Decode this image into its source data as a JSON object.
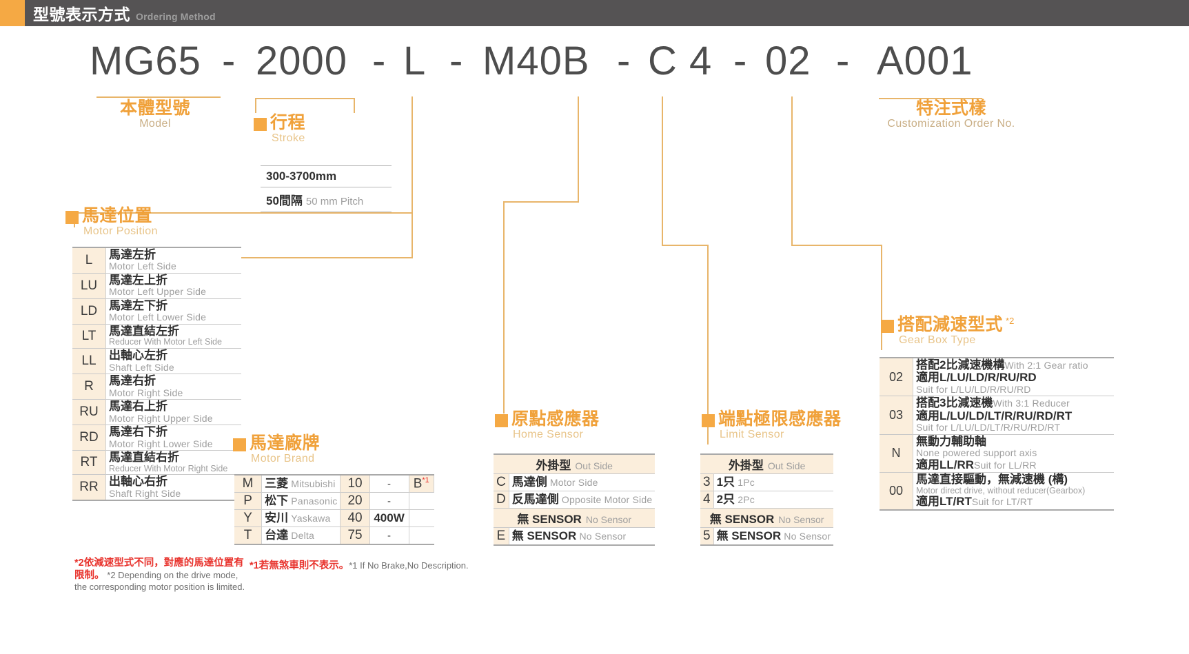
{
  "header": {
    "title_zh": "型號表示方式",
    "title_en": "Ordering Method"
  },
  "model_code": {
    "segments": [
      "MG65",
      "2000",
      "L",
      "M40B",
      "C 4",
      "02",
      "A001"
    ],
    "separator": "-"
  },
  "model": {
    "title_zh": "本體型號",
    "title_en": "Model"
  },
  "customization": {
    "title_zh": "特注式樣",
    "title_en": "Customization Order No."
  },
  "stroke": {
    "title_zh": "行程",
    "title_en": "Stroke",
    "rows": [
      {
        "value": "300-3700mm",
        "note": ""
      },
      {
        "value": "50間隔",
        "note": "50 mm Pitch"
      }
    ]
  },
  "motor_position": {
    "title_zh": "馬達位置",
    "title_en": "Motor Position",
    "rows": [
      {
        "code": "L",
        "zh": "馬達左折",
        "en": "Motor Left Side"
      },
      {
        "code": "LU",
        "zh": "馬達左上折",
        "en": "Motor Left Upper Side"
      },
      {
        "code": "LD",
        "zh": "馬達左下折",
        "en": "Motor Left Lower Side"
      },
      {
        "code": "LT",
        "zh": "馬達直結左折",
        "en": "Reducer With Motor Left Side"
      },
      {
        "code": "LL",
        "zh": "出軸心左折",
        "en": "Shaft Left Side"
      },
      {
        "code": "R",
        "zh": "馬達右折",
        "en": "Motor Right Side"
      },
      {
        "code": "RU",
        "zh": "馬達右上折",
        "en": "Motor Right Upper Side"
      },
      {
        "code": "RD",
        "zh": "馬達右下折",
        "en": "Motor Right Lower Side"
      },
      {
        "code": "RT",
        "zh": "馬達直結右折",
        "en": "Reducer With Motor Right Side"
      },
      {
        "code": "RR",
        "zh": "出軸心右折",
        "en": "Shaft Right Side"
      }
    ],
    "footnote_zh": "*2依減速型式不同，對應的馬達位置有限制。",
    "footnote_en": "*2 Depending on the drive mode, the corresponding motor position is limited."
  },
  "motor_brand": {
    "title_zh": "馬達廠牌",
    "title_en": "Motor Brand",
    "rows": [
      {
        "code": "M",
        "zh": "三菱",
        "en": "Mitsubishi",
        "watt_code": "10",
        "watt": "-",
        "brake": "B",
        "brake_sup": "*1"
      },
      {
        "code": "P",
        "zh": "松下",
        "en": "Panasonic",
        "watt_code": "20",
        "watt": "-",
        "brake": "",
        "brake_sup": ""
      },
      {
        "code": "Y",
        "zh": "安川",
        "en": "Yaskawa",
        "watt_code": "40",
        "watt": "400W",
        "brake": "",
        "brake_sup": ""
      },
      {
        "code": "T",
        "zh": "台達",
        "en": "Delta",
        "watt_code": "75",
        "watt": "-",
        "brake": "",
        "brake_sup": ""
      }
    ],
    "footnote_zh": "*1若無煞車則不表示。",
    "footnote_en": "*1 If No Brake,No Description."
  },
  "home_sensor": {
    "title_zh": "原點感應器",
    "title_en": "Home Sensor",
    "group_header_zh": "外掛型",
    "group_header_en": "Out Side",
    "rows": [
      {
        "code": "C",
        "zh": "馬達側",
        "en": "Motor Side"
      },
      {
        "code": "D",
        "zh": "反馬達側",
        "en": "Opposite Motor Side"
      }
    ],
    "nosensor_header_zh": "無 SENSOR",
    "nosensor_header_en": "No Sensor",
    "nosensor_rows": [
      {
        "code": "E",
        "zh": "無 SENSOR",
        "en": "No Sensor"
      }
    ]
  },
  "limit_sensor": {
    "title_zh": "端點極限感應器",
    "title_en": "Limit Sensor",
    "group_header_zh": "外掛型",
    "group_header_en": "Out Side",
    "rows": [
      {
        "code": "3",
        "zh": "1只",
        "en": "1Pc"
      },
      {
        "code": "4",
        "zh": "2只",
        "en": "2Pc"
      }
    ],
    "nosensor_header_zh": "無 SENSOR",
    "nosensor_header_en": "No Sensor",
    "nosensor_rows": [
      {
        "code": "5",
        "zh": "無 SENSOR",
        "en": "No Sensor"
      }
    ]
  },
  "gear_box": {
    "title_zh": "搭配減速型式",
    "title_sup": "*2",
    "title_en": "Gear Box Type",
    "rows": [
      {
        "code": "02",
        "zh1": "搭配2比減速機構",
        "en1": "With 2:1 Gear ratio",
        "zh2": "適用L/LU/LD/R/RU/RD",
        "en2": "Suit for L/LU/LD/R/RU/RD"
      },
      {
        "code": "03",
        "zh1": "搭配3比減速機",
        "en1": "With 3:1 Reducer",
        "zh2": "適用L/LU/LD/LT/R/RU/RD/RT",
        "en2": "Suit for L/LU/LD/LT/R/RU/RD/RT"
      },
      {
        "code": "N",
        "zh1": "無動力輔助軸",
        "en1": "None powered support axis",
        "zh2": "適用LL/RR",
        "en2": "Suit for LL/RR"
      },
      {
        "code": "00",
        "zh1": "馬達直接驅動，無減速機 (構)",
        "en1": "Motor direct drive, without reducer(Gearbox)",
        "zh2": "適用LT/RT",
        "en2": "Suit for LT/RT"
      }
    ]
  },
  "colors": {
    "accent_orange": "#f5a944",
    "title_orange": "#f0a13a",
    "header_gray": "#555354",
    "cell_cream": "#fbeedc",
    "red_note": "#e8322c"
  }
}
